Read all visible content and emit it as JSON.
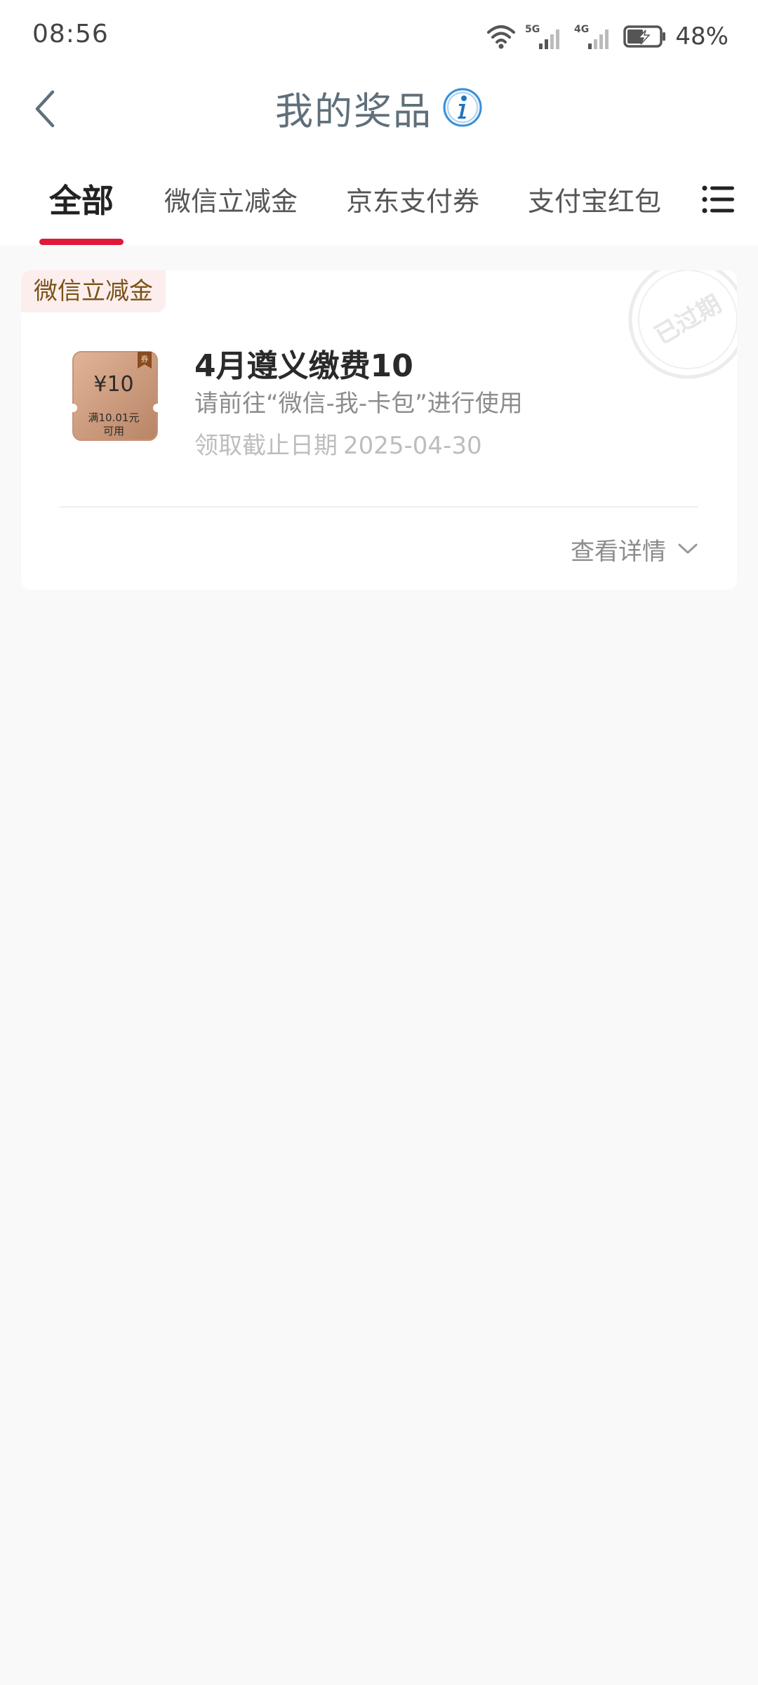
{
  "status_bar": {
    "time": "08:56",
    "battery": "48%",
    "network_labels": [
      "5G",
      "4G"
    ]
  },
  "header": {
    "title": "我的奖品",
    "back_icon": "chevron-left-icon",
    "info_icon": "info-icon"
  },
  "tabs": {
    "items": [
      {
        "label": "全部",
        "active": true
      },
      {
        "label": "微信立减金",
        "active": false
      },
      {
        "label": "京东支付券",
        "active": false
      },
      {
        "label": "支付宝红包",
        "active": false
      }
    ],
    "menu_icon": "list-menu-icon",
    "accent_color": "#e0193a"
  },
  "prize_card": {
    "tag": "微信立减金",
    "stamp": "已过期",
    "coupon": {
      "amount": "¥10",
      "condition_line1": "满10.01元",
      "condition_line2": "可用",
      "corner": "券"
    },
    "title": "4月遵义缴费10",
    "instruction": "请前往“微信-我-卡包”进行使用",
    "deadline_label": "领取截止日期",
    "deadline_value": "2025-04-30",
    "detail_label": "查看详情"
  }
}
